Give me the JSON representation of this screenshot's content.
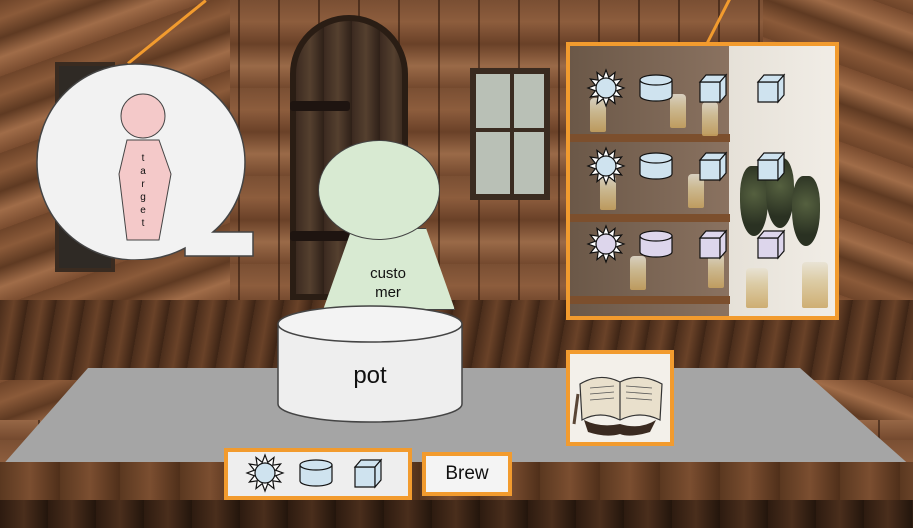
{
  "target": {
    "label_letters": [
      "t",
      "a",
      "r",
      "g",
      "e",
      "t"
    ]
  },
  "customer": {
    "label_line1": "custo",
    "label_line2": "mer"
  },
  "pot": {
    "label": "pot"
  },
  "brew_button": {
    "label": "Brew"
  },
  "shelf": {
    "rows": [
      {
        "items": [
          "sun-icon",
          "cylinder-icon",
          "cube-icon",
          "cube-icon"
        ],
        "color": "#cfe3ef"
      },
      {
        "items": [
          "sun-icon",
          "cylinder-icon",
          "cube-icon",
          "cube-icon"
        ],
        "color": "#cfe3ef"
      },
      {
        "items": [
          "sun-icon",
          "cylinder-icon",
          "cube-icon",
          "cube-icon"
        ],
        "color": "#ddd6ec"
      }
    ]
  },
  "inventory": {
    "items": [
      "sun-icon",
      "cylinder-icon",
      "cube-icon"
    ],
    "color": "#cfe3ef"
  },
  "colors": {
    "accent": "#f29b2e",
    "customer": "#d8ead2",
    "target": "#f4c9c9",
    "pot": "#eeeeee"
  }
}
